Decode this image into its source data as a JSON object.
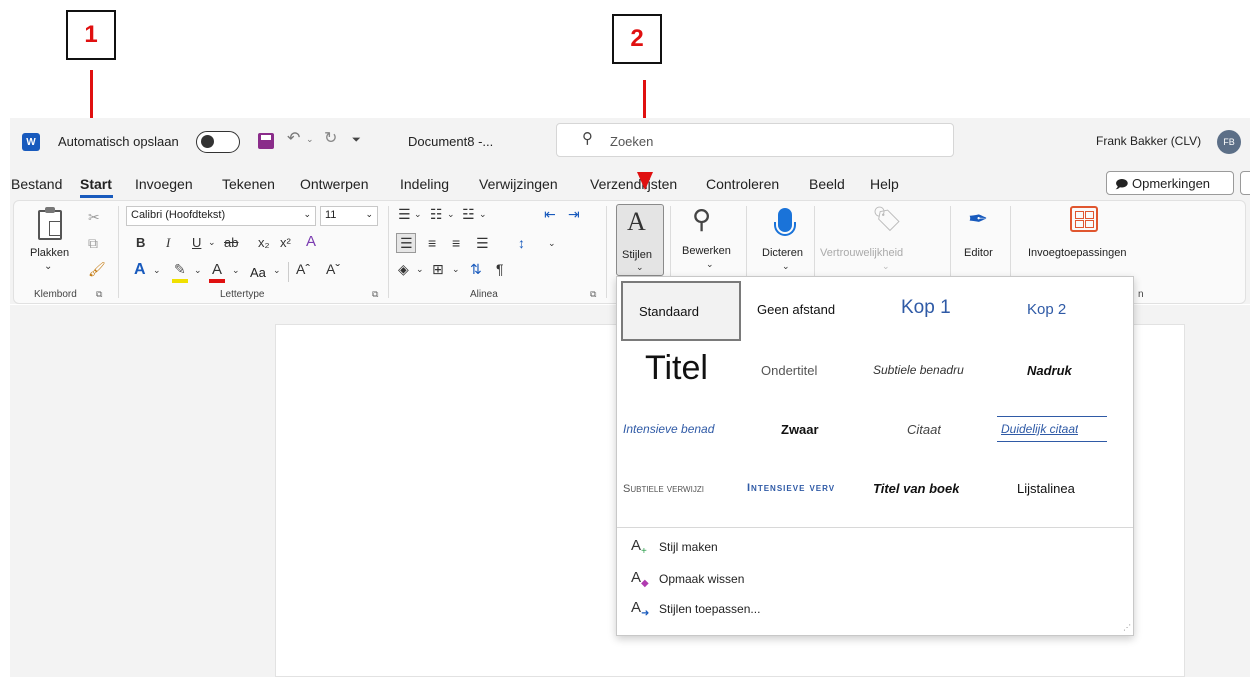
{
  "callouts": {
    "one": "1",
    "two": "2"
  },
  "titlebar": {
    "autosave_label": "Automatisch opslaan",
    "doc_name": "Document8 -...",
    "search_placeholder": "Zoeken",
    "user_name": "Frank Bakker (CLV)",
    "user_initials": "FB"
  },
  "menu": {
    "items": [
      "Bestand",
      "Start",
      "Invoegen",
      "Tekenen",
      "Ontwerpen",
      "Indeling",
      "Verwijzingen",
      "Verzendlijsten",
      "Controleren",
      "Beeld",
      "Help"
    ],
    "comments_button": "Opmerkingen"
  },
  "ribbon": {
    "clipboard": {
      "paste_label": "Plakken",
      "group_label": "Klembord"
    },
    "font": {
      "font_name": "Calibri (Hoofdtekst)",
      "font_size": "11",
      "group_label": "Lettertype",
      "case_label": "Aa"
    },
    "paragraph": {
      "group_label": "Alinea"
    },
    "styles_button": "Stijlen",
    "edit_button": "Bewerken",
    "dictate_button": "Dicteren",
    "sensitivity_button": "Vertrouwelijkheid",
    "editor_button": "Editor",
    "addins_button": "Invoegtoepassingen",
    "truncated_group_tail": "n"
  },
  "gallery": {
    "styles": [
      {
        "label": "Standaard"
      },
      {
        "label": "Geen afstand"
      },
      {
        "label": "Kop 1"
      },
      {
        "label": "Kop 2"
      },
      {
        "label": "Titel"
      },
      {
        "label": "Ondertitel"
      },
      {
        "label": "Subtiele benadru"
      },
      {
        "label": "Nadruk"
      },
      {
        "label": "Intensieve benad"
      },
      {
        "label": "Zwaar"
      },
      {
        "label": "Citaat"
      },
      {
        "label": "Duidelijk citaat"
      },
      {
        "label": "Subtiele verwijzi"
      },
      {
        "label": "Intensieve verv"
      },
      {
        "label": "Titel van boek"
      },
      {
        "label": "Lijstalinea"
      }
    ],
    "actions": [
      {
        "icon": "A+",
        "label": "Stijl maken"
      },
      {
        "icon": "A-eraser",
        "label": "Opmaak wissen"
      },
      {
        "icon": "A-arrow",
        "label": "Stijlen toepassen..."
      }
    ]
  },
  "colors": {
    "accent": "#185abd",
    "callout_red": "#e01010",
    "save_purple": "#8a2c8a"
  }
}
